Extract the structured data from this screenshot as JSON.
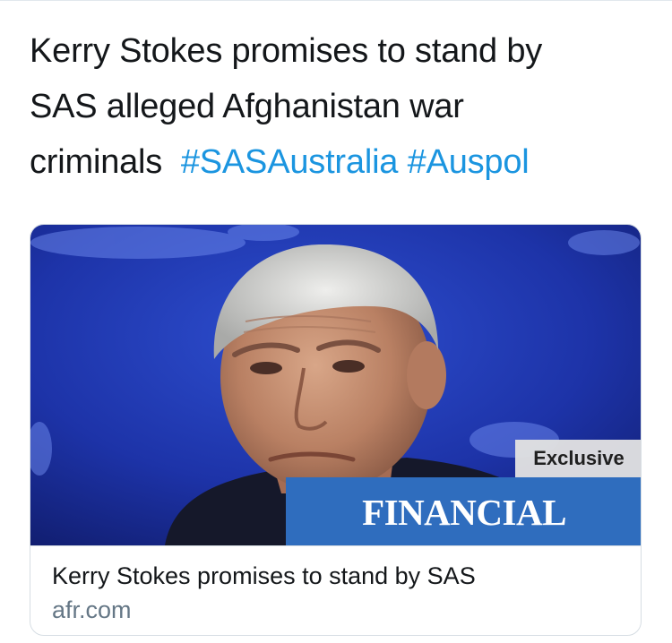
{
  "tweet": {
    "text_lines": [
      "Kerry Stokes promises to stand by",
      "SAS alleged Afghanistan war",
      "criminals"
    ],
    "hashtags": [
      "#SASAustralia",
      "#Auspol"
    ]
  },
  "card": {
    "image_alt": "photo of an elderly man with grey hair against a blue stage backdrop",
    "badge_exclusive": "Exclusive",
    "badge_publication": "FINANCIAL REVIEW",
    "title": "Kerry Stokes promises to stand by SAS",
    "domain": "afr.com"
  },
  "colors": {
    "text": "#14171a",
    "hashtag": "#1b95e0",
    "secondary": "#657786",
    "afr_blue": "#2f6dbe",
    "border": "#d6dde3"
  }
}
